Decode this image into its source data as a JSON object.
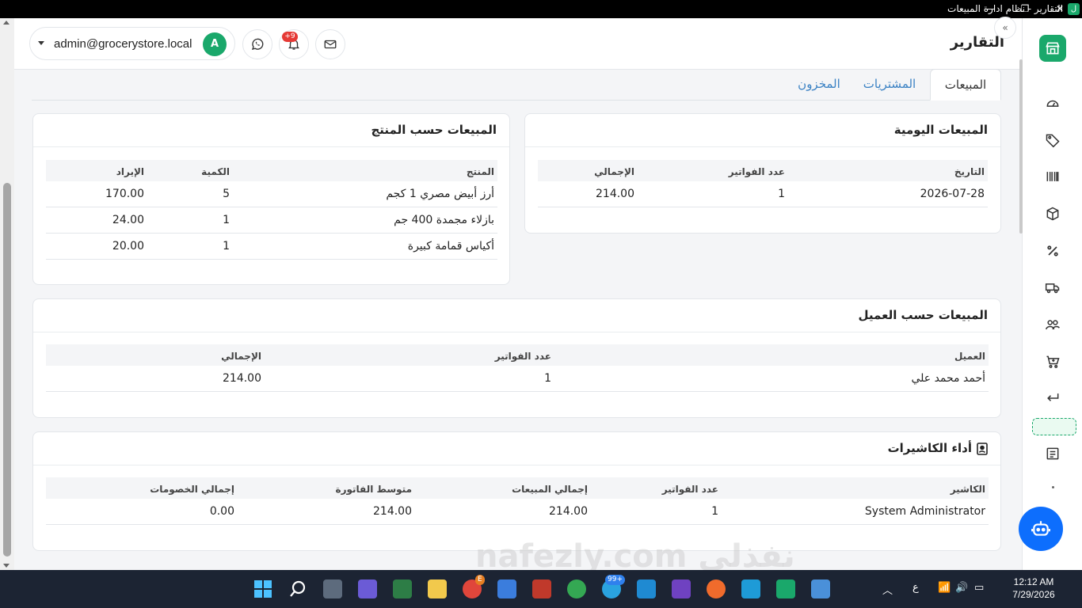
{
  "window": {
    "title": "التقارير - نظام ادارة المبيعات",
    "minimize": "—",
    "maximize": "❐",
    "close": "✕",
    "app_icon": "ل"
  },
  "header": {
    "page_title": "التقارير",
    "user_email": "admin@grocerystore.local",
    "user_initial": "A",
    "notification_badge": "+9",
    "collapse": "«"
  },
  "tabs": [
    {
      "label": "المبيعات",
      "active": true
    },
    {
      "label": "المشتريات",
      "active": false
    },
    {
      "label": "المخزون",
      "active": false
    }
  ],
  "daily_sales": {
    "title": "المبيعات اليومية",
    "headers": [
      "التاريخ",
      "عدد الفواتير",
      "الإجمالي"
    ],
    "rows": [
      [
        "2026-07-28",
        "1",
        "214.00"
      ]
    ]
  },
  "sales_by_product": {
    "title": "المبيعات حسب المنتج",
    "headers": [
      "المنتج",
      "الكمية",
      "الإيراد"
    ],
    "rows": [
      [
        "أرز أبيض مصري 1 كجم",
        "5",
        "170.00"
      ],
      [
        "بازلاء مجمدة 400 جم",
        "1",
        "24.00"
      ],
      [
        "أكياس قمامة كبيرة",
        "1",
        "20.00"
      ]
    ]
  },
  "sales_by_customer": {
    "title": "المبيعات حسب العميل",
    "headers": [
      "العميل",
      "عدد الفواتير",
      "الإجمالي"
    ],
    "rows": [
      [
        "أحمد محمد علي",
        "1",
        "214.00"
      ]
    ]
  },
  "cashier_performance": {
    "title": "أداء الكاشيرات",
    "headers": [
      "الكاشير",
      "عدد الفواتير",
      "إجمالي المبيعات",
      "متوسط الفاتورة",
      "إجمالي الخصومات"
    ],
    "rows": [
      [
        "System Administrator",
        "1",
        "214.00",
        "214.00",
        "0.00"
      ]
    ]
  },
  "taskbar": {
    "time": "12:12 AM",
    "date": "7/29/2026",
    "lang": "ع",
    "telegram_badge": "99+",
    "opera_badge": "E"
  },
  "watermark": "نفذلي nafezly.com",
  "colors": {
    "brand_green": "#1aa86b",
    "link_blue": "#3b82c4",
    "fab_blue": "#0d6efd",
    "badge_red": "#e53935"
  }
}
